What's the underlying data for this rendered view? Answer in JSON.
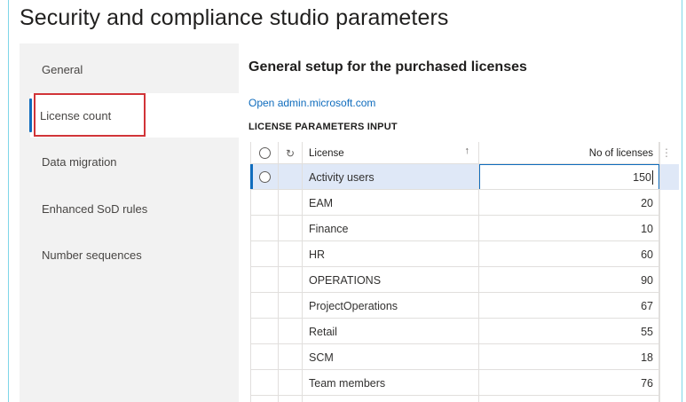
{
  "page": {
    "title": "Security and compliance studio parameters"
  },
  "sidebar": {
    "items": [
      {
        "label": "General"
      },
      {
        "label": "License count"
      },
      {
        "label": "Data migration"
      },
      {
        "label": "Enhanced SoD rules"
      },
      {
        "label": "Number sequences"
      }
    ],
    "active_index": 1
  },
  "main": {
    "section_title": "General setup for the purchased licenses",
    "link_text": "Open admin.microsoft.com",
    "group_title": "LICENSE PARAMETERS INPUT"
  },
  "grid": {
    "columns": {
      "license": "License",
      "count": "No of licenses"
    },
    "icons": {
      "select": "radio-icon",
      "refresh": "refresh-icon",
      "sort": "sort-arrow-up-icon",
      "more": "more-options-icon"
    },
    "rows": [
      {
        "license": "Activity users",
        "count": "150",
        "selected": true
      },
      {
        "license": "EAM",
        "count": "20"
      },
      {
        "license": "Finance",
        "count": "10"
      },
      {
        "license": "HR",
        "count": "60"
      },
      {
        "license": "OPERATIONS",
        "count": "90"
      },
      {
        "license": "ProjectOperations",
        "count": "67"
      },
      {
        "license": "Retail",
        "count": "55"
      },
      {
        "license": "SCM",
        "count": "18"
      },
      {
        "license": "Team members",
        "count": "76"
      }
    ]
  },
  "colors": {
    "accent": "#0f6cbd",
    "highlight_box": "#d13438",
    "sidebar_bg": "#f2f2f2",
    "selected_row": "#dfe8f7"
  }
}
